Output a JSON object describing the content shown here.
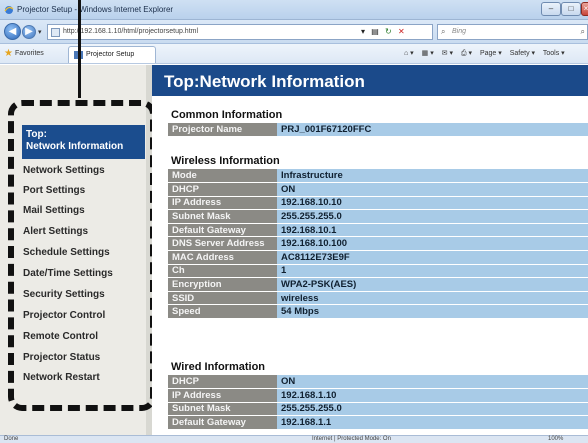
{
  "browser": {
    "window_title": "Projector Setup - Windows Internet Explorer",
    "url": "http://192.168.1.10/html/projectorsetup.html",
    "search_placeholder": "Bing",
    "favorites_label": "Favorites",
    "tab_label": "Projector Setup",
    "command_bar": [
      "Page ▾",
      "Safety ▾",
      "Tools ▾"
    ],
    "status_text": "Done",
    "zone_text": "Internet | Protected Mode: On",
    "zoom_text": "100%"
  },
  "sidebar": {
    "active_line1": "Top:",
    "active_line2": "Network Information",
    "items": [
      "Network Settings",
      "Port Settings",
      "Mail Settings",
      "Alert Settings",
      "Schedule Settings",
      "Date/Time Settings",
      "Security Settings",
      "Projector Control",
      "Remote Control",
      "Projector Status",
      "Network Restart"
    ]
  },
  "main": {
    "title": "Top:Network Information",
    "common": {
      "heading": "Common Information",
      "rows": [
        {
          "key": "Projector Name",
          "value": "PRJ_001F67120FFC"
        }
      ]
    },
    "wireless": {
      "heading": "Wireless Information",
      "rows": [
        {
          "key": "Mode",
          "value": "Infrastructure"
        },
        {
          "key": "DHCP",
          "value": "ON"
        },
        {
          "key": "IP Address",
          "value": "192.168.10.10"
        },
        {
          "key": "Subnet Mask",
          "value": "255.255.255.0"
        },
        {
          "key": "Default Gateway",
          "value": "192.168.10.1"
        },
        {
          "key": "DNS Server Address",
          "value": "192.168.10.100"
        },
        {
          "key": "MAC Address",
          "value": "AC8112E73E9F"
        },
        {
          "key": "Ch",
          "value": "1"
        },
        {
          "key": "Encryption",
          "value": "WPA2-PSK(AES)"
        },
        {
          "key": "SSID",
          "value": "wireless"
        },
        {
          "key": "Speed",
          "value": "54 Mbps"
        }
      ]
    },
    "wired": {
      "heading": "Wired Information",
      "rows": [
        {
          "key": "DHCP",
          "value": "ON"
        },
        {
          "key": "IP Address",
          "value": "192.168.1.10"
        },
        {
          "key": "Subnet Mask",
          "value": "255.255.255.0"
        },
        {
          "key": "Default Gateway",
          "value": "192.168.1.1"
        }
      ]
    }
  }
}
